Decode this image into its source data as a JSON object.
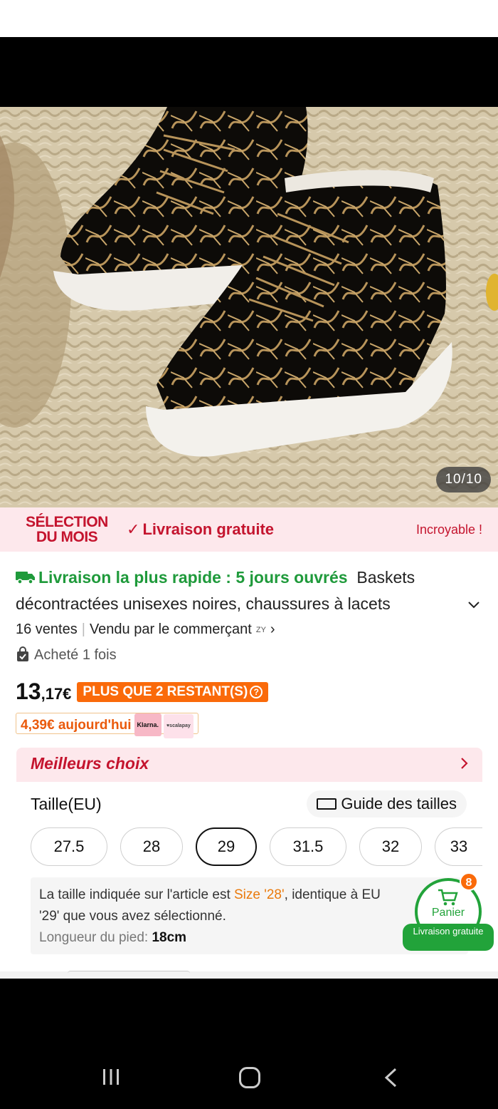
{
  "gallery": {
    "counter": "10/10"
  },
  "promo": {
    "selection": "SÉLECTION DU MOIS",
    "free_shipping": "Livraison gratuite",
    "incroyable": "Incroyable !"
  },
  "product": {
    "fast_delivery": "Livraison la plus rapide : 5 jours ouvrés",
    "title": "Baskets décontractées unisexes noires, chaussures à lacets",
    "sales": "16 ventes",
    "seller": "Vendu par le commerçant",
    "seller_badge": "ZY",
    "bought": "Acheté 1 fois",
    "price_int": "13",
    "price_dec": ",17€",
    "stock": "PLUS QUE 2 RESTANT(S)",
    "installment": "4,39€ aujourd'hui",
    "badge_klarna": "Klarna.",
    "badge_scalapay": "♥scalapay"
  },
  "best": {
    "title": "Meilleurs choix",
    "size_label": "Taille(EU)",
    "guide": "Guide des tailles",
    "sizes": [
      "27.5",
      "28",
      "29",
      "31.5",
      "32",
      "33"
    ],
    "selected_size": "29",
    "note_part1": "La taille indiquée sur l'article est ",
    "note_size": "Size '28'",
    "note_part2": ", identique à EU",
    "note_line2": "'29' que vous avez sélectionné.",
    "foot_label": "Longueur du pied: ",
    "foot_value": "18cm"
  },
  "cart": {
    "count": "8",
    "label": "Panier",
    "ribbon": "Livraison gratuite"
  },
  "colors": {
    "accent_red": "#c4142e",
    "green": "#22a33a",
    "orange": "#fa6a0a",
    "pink_bg": "#fde8ec"
  }
}
